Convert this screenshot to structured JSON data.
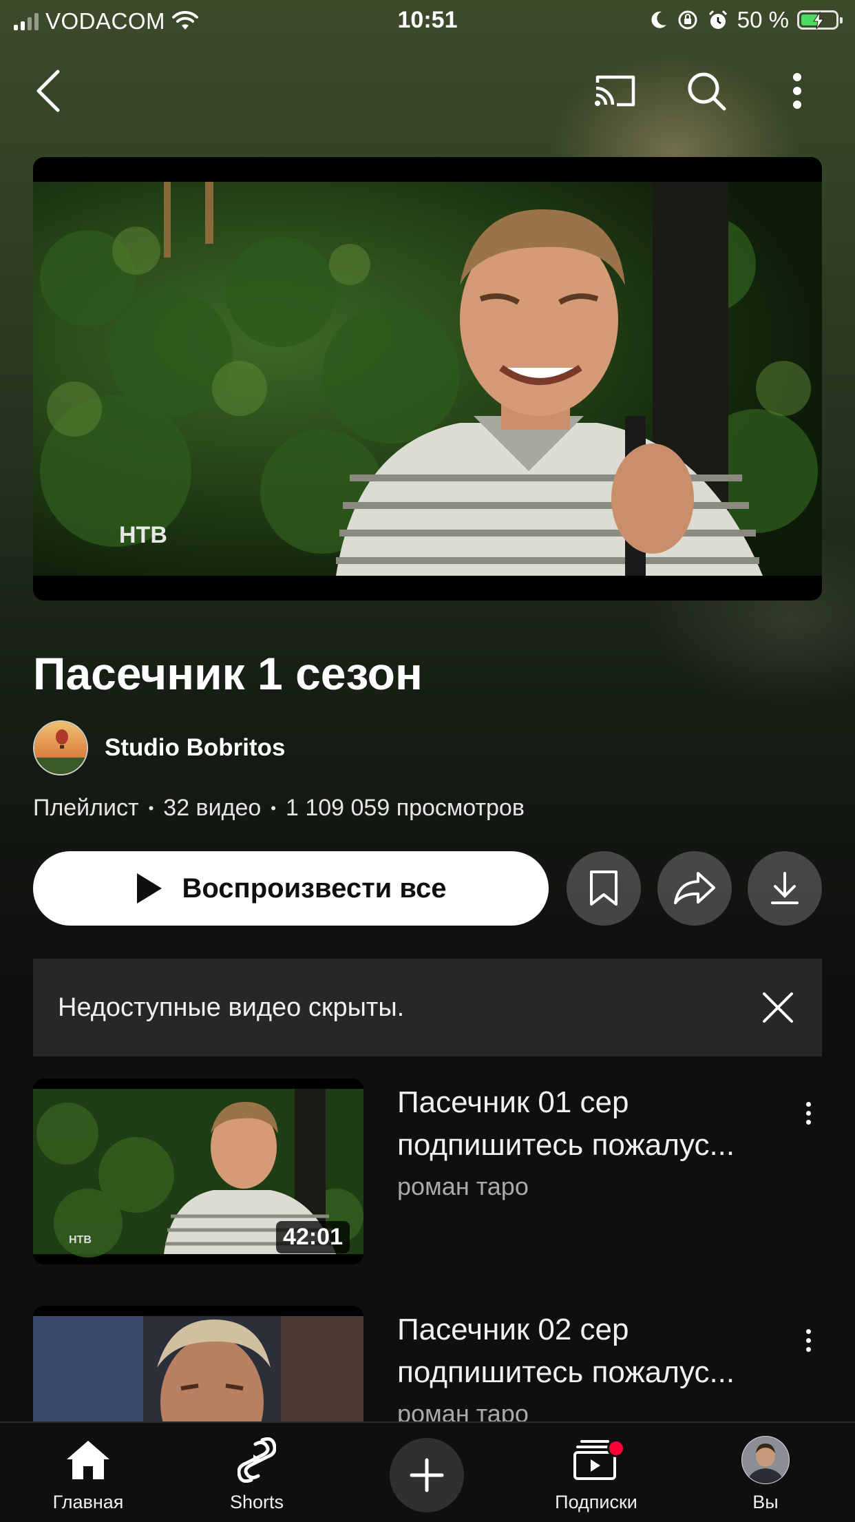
{
  "status_bar": {
    "carrier": "VODACOM",
    "time": "10:51",
    "battery_percent": "50 %",
    "battery_level": 0.5
  },
  "top_bar": {
    "icons": [
      "back-icon",
      "cast-icon",
      "search-icon",
      "more-vert-icon"
    ]
  },
  "playlist": {
    "title": "Пасечник 1 сезон",
    "channel_name": "Studio Bobritos",
    "type": "Плейлист",
    "video_count": "32 видео",
    "views": "1 109 059 просмотров",
    "hero_logo": "НТВ",
    "play_all_label": "Воспроизвести все"
  },
  "notice": {
    "text": "Недоступные видео скрыты."
  },
  "videos": [
    {
      "title_line1": "Пасечник 01 сер",
      "title_line2": "подпишитесь пожалус...",
      "author": "роман таро",
      "duration": "42:01",
      "logo": "НТВ"
    },
    {
      "title_line1": "Пасечник 02 сер",
      "title_line2": "подпишитесь пожалус...",
      "author": "роман таро"
    }
  ],
  "bottom_nav": {
    "home": "Главная",
    "shorts": "Shorts",
    "subscriptions": "Подписки",
    "you": "Вы"
  },
  "colors": {
    "background": "#0f0f0f",
    "notice_bg": "#272727",
    "notification_dot": "#ff0033",
    "battery_fill": "#4cd964"
  }
}
